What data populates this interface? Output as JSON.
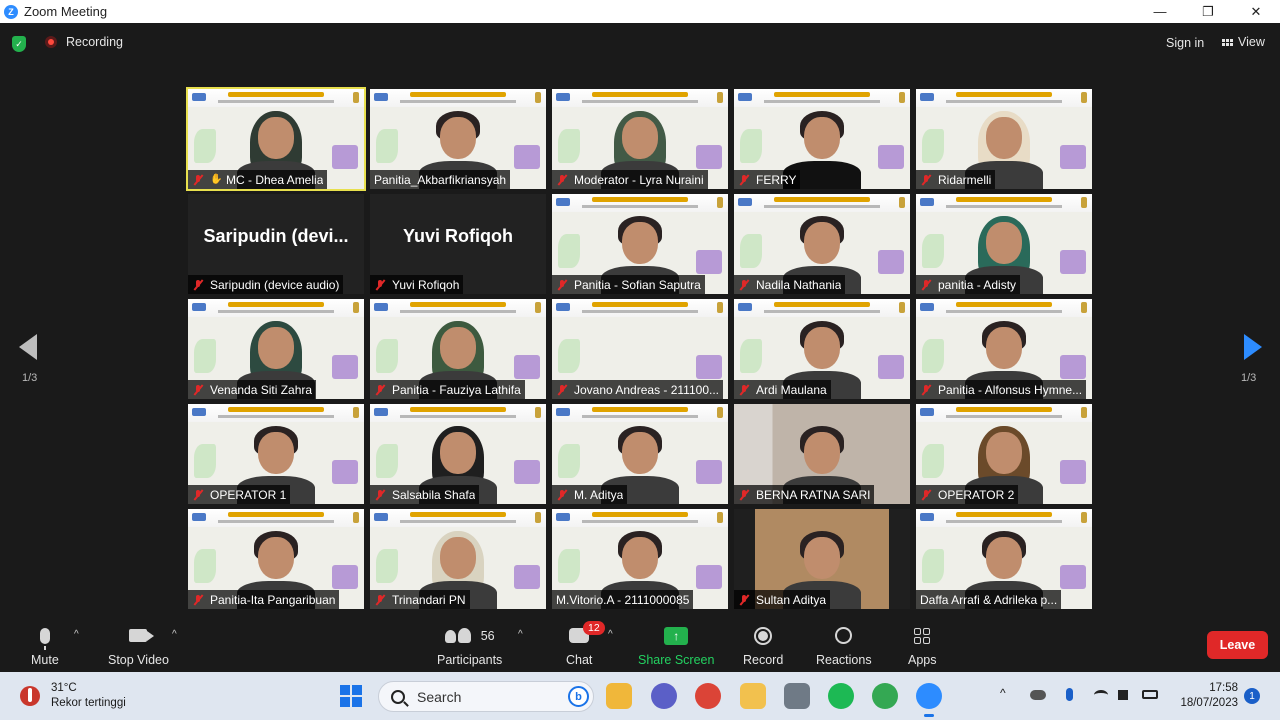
{
  "window": {
    "title": "Zoom Meeting",
    "logo": "Z",
    "minimize": "—",
    "maximize": "❐",
    "close": "✕"
  },
  "topbar": {
    "recording": "Recording",
    "sign_in": "Sign in",
    "view": "View"
  },
  "gallery": {
    "page_left": "1/3",
    "page_right": "1/3",
    "tiles": [
      {
        "name": "MC - Dhea Amelia",
        "muted": true,
        "hand": true,
        "active": true,
        "kind": "video",
        "hijab": "#2f3b33"
      },
      {
        "name": "Panitia_Akbarfikriansyah",
        "muted": false,
        "kind": "video",
        "hair": true
      },
      {
        "name": "Moderator - Lyra Nuraini",
        "muted": true,
        "kind": "video",
        "hijab": "#425a46"
      },
      {
        "name": "FERRY",
        "muted": true,
        "kind": "video",
        "hair": true,
        "dark": true
      },
      {
        "name": "Ridarmelli",
        "muted": true,
        "kind": "video",
        "hijab": "#e8dcc6"
      },
      {
        "name": "Saripudin (device audio)",
        "big": "Saripudin  (devi...",
        "muted": true,
        "kind": "text"
      },
      {
        "name": "Yuvi Rofiqoh",
        "big": "Yuvi Rofiqoh",
        "muted": true,
        "kind": "text"
      },
      {
        "name": "Panitia - Sofian Saputra",
        "muted": true,
        "kind": "video",
        "hair": true
      },
      {
        "name": "Nadila Nathania",
        "muted": true,
        "kind": "video",
        "hair": true
      },
      {
        "name": "panitia - Adisty",
        "muted": true,
        "kind": "video",
        "hijab": "#2a6a5a"
      },
      {
        "name": "Venanda Siti Zahra",
        "muted": true,
        "kind": "video",
        "hijab": "#2d4a40"
      },
      {
        "name": "Panitia - Fauziya Lathifa",
        "muted": true,
        "kind": "video",
        "hijab": "#3d5a3f"
      },
      {
        "name": "Jovano Andreas - 211100...",
        "muted": true,
        "kind": "video",
        "empty": true
      },
      {
        "name": "Ardi Maulana",
        "muted": true,
        "kind": "video",
        "hair": true
      },
      {
        "name": "Panitia - Alfonsus Hymne...",
        "muted": true,
        "kind": "video",
        "hair": true
      },
      {
        "name": "OPERATOR 1",
        "muted": true,
        "kind": "video",
        "hair": true
      },
      {
        "name": "Salsabila Shafa",
        "muted": true,
        "kind": "video",
        "hijab": "#1f1f1f"
      },
      {
        "name": "M. Aditya",
        "muted": true,
        "kind": "video",
        "hair": true
      },
      {
        "name": "BERNA RATNA SARI",
        "muted": true,
        "kind": "video",
        "hair": true,
        "room": true
      },
      {
        "name": "OPERATOR 2",
        "muted": true,
        "kind": "video",
        "hijab": "#6b4a2a"
      },
      {
        "name": "Panitia-Ita Pangaribuan",
        "muted": true,
        "kind": "video",
        "hair": true
      },
      {
        "name": "Trinandari PN",
        "muted": true,
        "kind": "video",
        "hijab": "#d9d3c0"
      },
      {
        "name": "M.Vitorio.A - 2111000085",
        "muted": false,
        "kind": "video",
        "hair": true
      },
      {
        "name": "Sultan Aditya",
        "muted": true,
        "kind": "video",
        "hair": true,
        "blue": true
      },
      {
        "name": "Daffa Arrafi & Adrileka p...",
        "muted": false,
        "kind": "video",
        "hair": true
      }
    ]
  },
  "toolbar": {
    "mute": "Mute",
    "stop_video": "Stop Video",
    "participants_count": "56",
    "participants": "Participants",
    "chat_badge": "12",
    "chat": "Chat",
    "share_screen": "Share Screen",
    "record": "Record",
    "reactions": "Reactions",
    "apps": "Apps",
    "leave": "Leave",
    "caret": "^"
  },
  "taskbar": {
    "temperature": "31°C",
    "weather_text": "Rekor tertinggi",
    "search": "Search",
    "bing": "b",
    "time": "17:58",
    "date": "18/07/2023",
    "notifications": "1",
    "tray_chevron": "^",
    "apps": [
      {
        "icon": "file-explorer-icon",
        "color": "#f0b73a"
      },
      {
        "icon": "teams-icon",
        "color": "#5b5fc7"
      },
      {
        "icon": "chrome-icon",
        "color": "#db4437"
      },
      {
        "icon": "folder-icon",
        "color": "#f2c14e"
      },
      {
        "icon": "settings-icon",
        "color": "#6f7a86"
      },
      {
        "icon": "spotify-icon",
        "color": "#1db954"
      },
      {
        "icon": "chrome-profile-icon",
        "color": "#34a853"
      },
      {
        "icon": "zoom-icon",
        "color": "#2d8cff"
      }
    ]
  }
}
